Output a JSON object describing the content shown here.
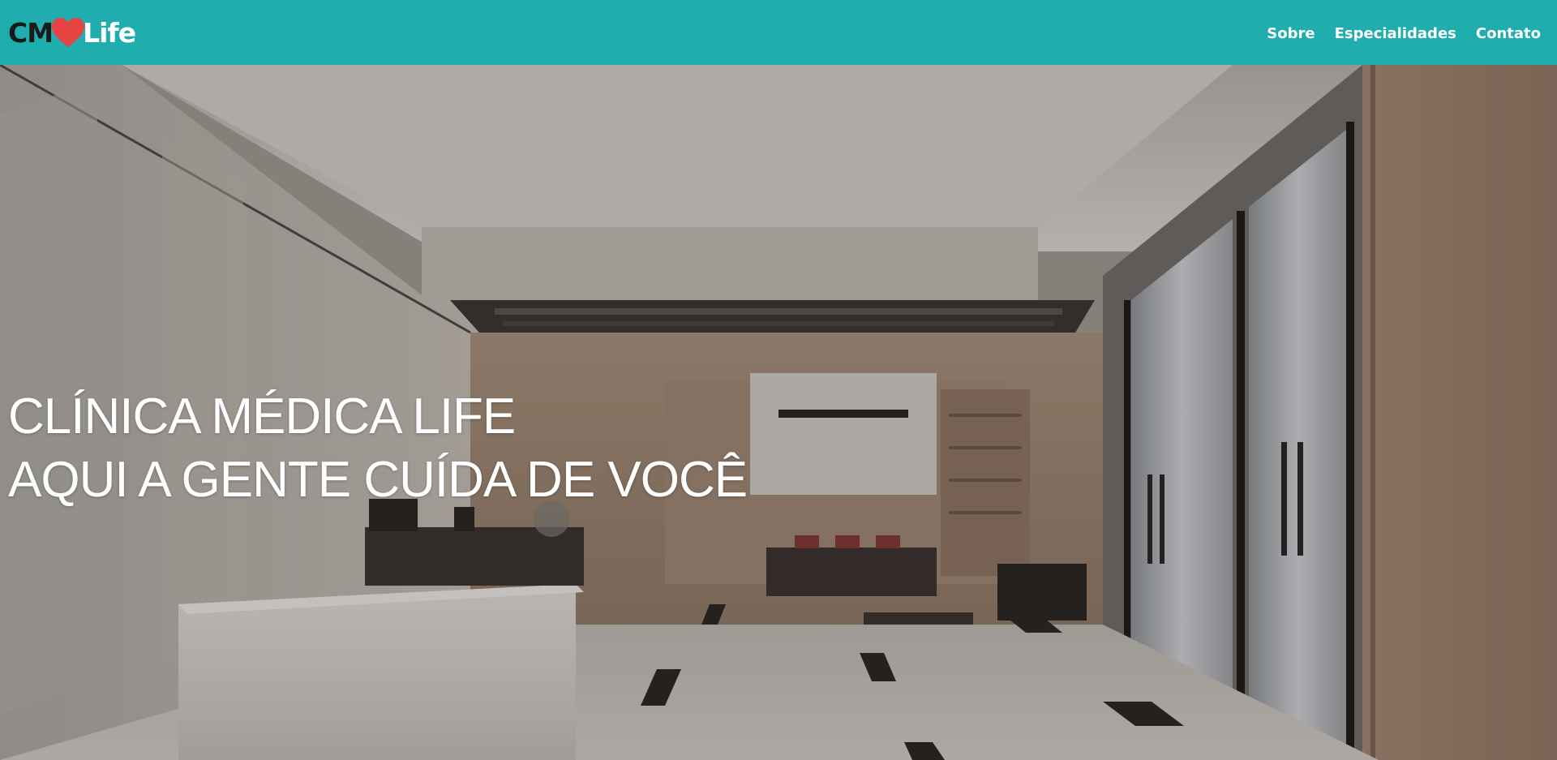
{
  "brand": {
    "prefix": "CM",
    "suffix": "Life",
    "heart_color": "#e84343",
    "heart_icon": "heart-icon"
  },
  "colors": {
    "navbar": "#20adad",
    "nav_text": "#ffffff",
    "hero_text": "#ffffff"
  },
  "nav": {
    "items": [
      {
        "label": "Sobre"
      },
      {
        "label": "Especialidades"
      },
      {
        "label": "Contato"
      }
    ]
  },
  "hero": {
    "title_line1": "CLÍNICA MÉDICA LIFE",
    "title_line2": "AQUI A GENTE CUÍDA DE VOCÊ",
    "background": "hospital-lobby-image"
  }
}
